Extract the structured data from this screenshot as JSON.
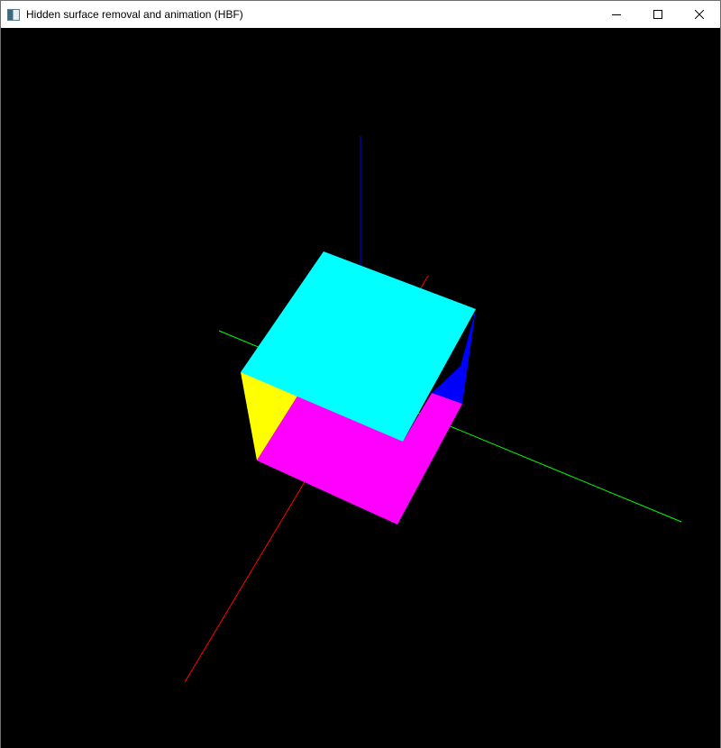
{
  "window": {
    "title": "Hidden surface removal and animation (HBF)",
    "icon": "app-window-icon",
    "controls": [
      "minimize-icon",
      "maximize-icon",
      "close-icon"
    ]
  },
  "scene": {
    "background": "#000000",
    "axes": {
      "x": {
        "color": "#ff0000"
      },
      "y": {
        "color": "#00ff00"
      },
      "z": {
        "color": "#0000ff"
      }
    },
    "cube_faces": [
      {
        "name": "top-face",
        "color": "#00ffff"
      },
      {
        "name": "front-face",
        "color": "#ff00ff"
      },
      {
        "name": "left-face",
        "color": "#ffff00"
      },
      {
        "name": "right-face",
        "color": "#0000ff"
      }
    ]
  }
}
